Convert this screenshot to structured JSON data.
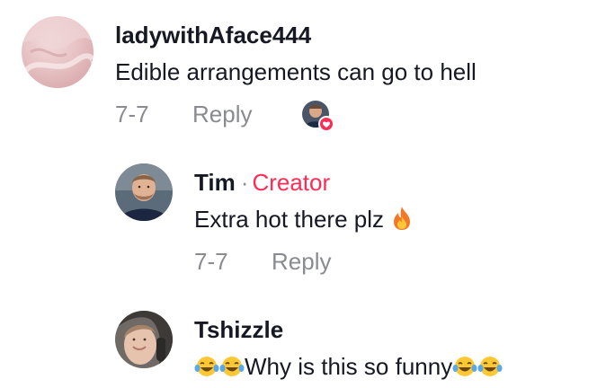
{
  "comments": [
    {
      "username": "ladywithAface444",
      "text": "Edible arrangements can go to hell",
      "date": "7-7",
      "reply_label": "Reply",
      "liked_by_creator": true
    },
    {
      "username": "Tim",
      "separator": "·",
      "badge": "Creator",
      "text": "Extra hot there plz",
      "text_emoji": "fire-emoji",
      "date": "7-7",
      "reply_label": "Reply"
    },
    {
      "username": "Tshizzle",
      "text": "Why is this so funny",
      "leading_emoji": [
        "tears-of-joy-emoji",
        "tears-of-joy-emoji"
      ],
      "trailing_emoji": [
        "tears-of-joy-emoji",
        "tears-of-joy-emoji"
      ]
    }
  ],
  "colors": {
    "text": "#161823",
    "muted": "#8a8b91",
    "creator": "#fe2c55"
  }
}
